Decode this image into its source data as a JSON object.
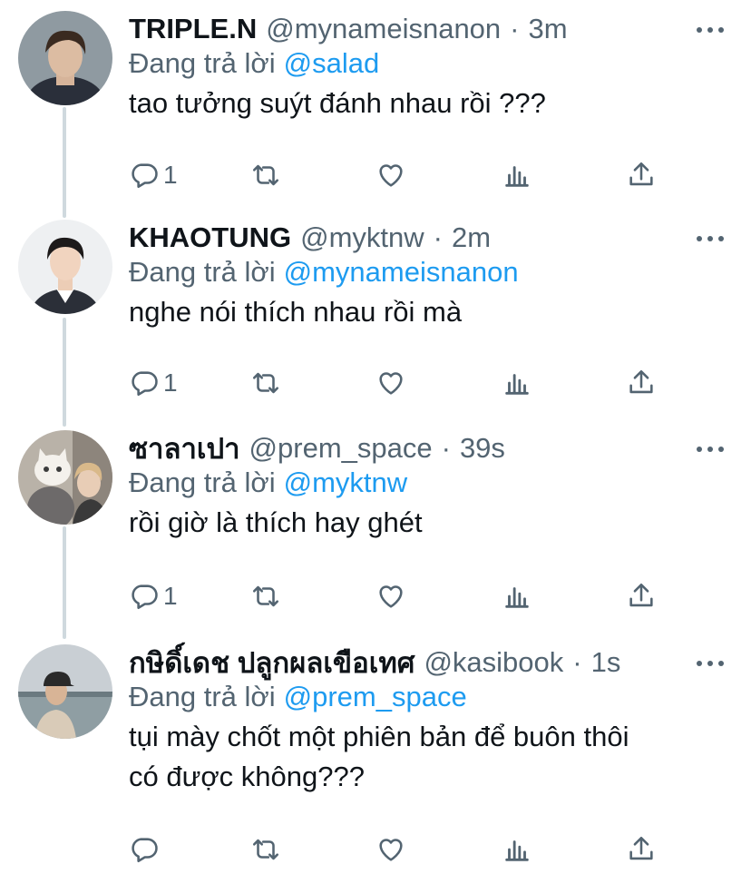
{
  "tweets": [
    {
      "display_name": "TRIPLE.N",
      "handle": "@mynameisnanon",
      "time": "3m",
      "reply_label": "Đang trả lời",
      "reply_to": "@salad",
      "text_lines": [
        "tao tưởng suýt đánh nhau rồi ???"
      ],
      "reply_count": "1"
    },
    {
      "display_name": "KHAOTUNG",
      "handle": "@myktnw",
      "time": "2m",
      "reply_label": "Đang trả lời",
      "reply_to": "@mynameisnanon",
      "text_lines": [
        "nghe nói thích nhau rồi mà"
      ],
      "reply_count": "1"
    },
    {
      "display_name": "ซาลาเปา",
      "handle": "@prem_space",
      "time": "39s",
      "reply_label": "Đang trả lời",
      "reply_to": "@myktnw",
      "text_lines": [
        "rồi giờ là thích hay ghét"
      ],
      "reply_count": "1"
    },
    {
      "display_name": "กษิดิ์เดช ปลูกผลเขือเทศ",
      "handle": "@kasibook",
      "time": "1s",
      "reply_label": "Đang trả lời",
      "reply_to": "@prem_space",
      "text_lines": [
        "tụi mày chốt một phiên bản để buôn thôi",
        "có được không???"
      ],
      "reply_count": ""
    }
  ],
  "icons": {
    "reply": "reply-icon",
    "retweet": "retweet-icon",
    "like": "heart-icon",
    "analytics": "analytics-icon",
    "share": "share-icon",
    "more": "more-icon"
  },
  "colors": {
    "text": "#0f1419",
    "muted": "#536471",
    "link": "#1d9bf0",
    "thread_line": "#cfd9de"
  }
}
